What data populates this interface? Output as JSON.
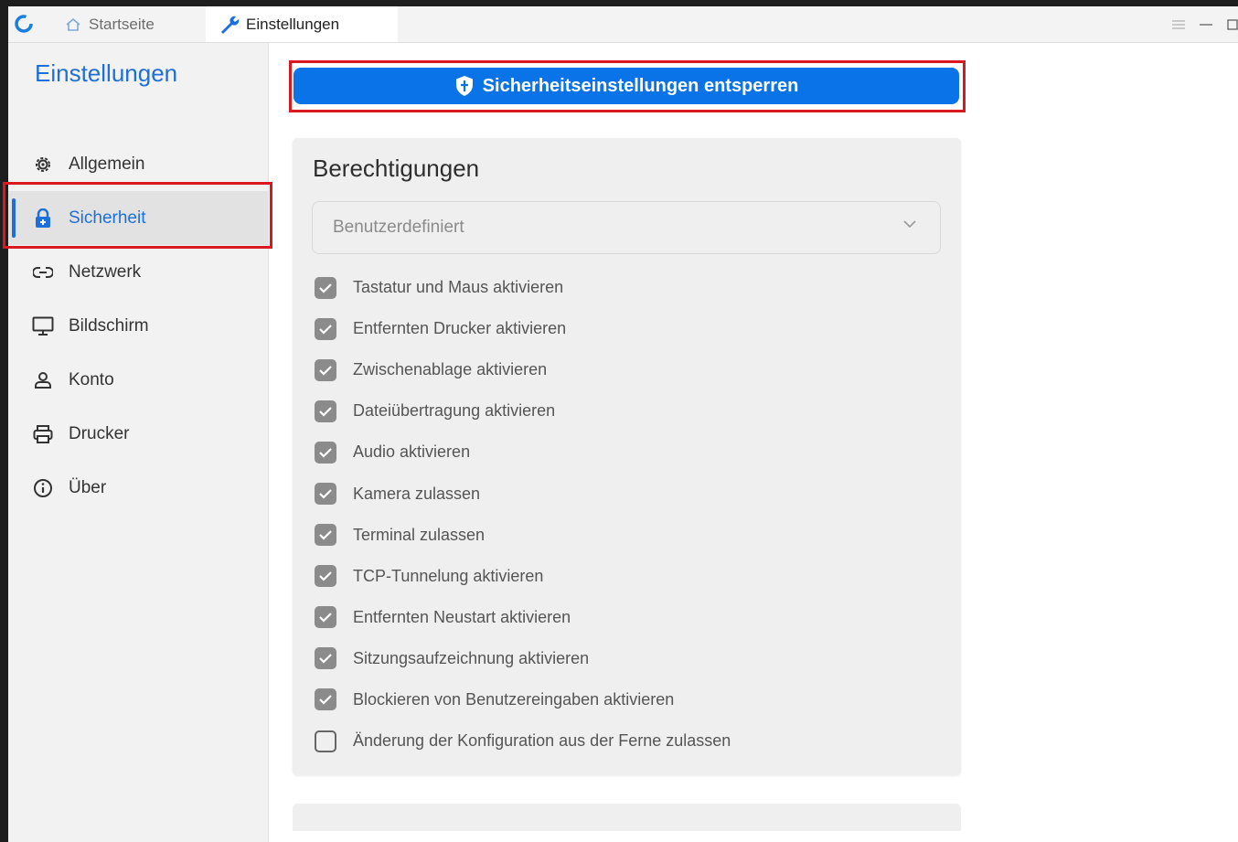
{
  "tabs": {
    "home_label": "Startseite",
    "settings_label": "Einstellungen"
  },
  "sidebar": {
    "title": "Einstellungen",
    "items": [
      {
        "label": "Allgemein",
        "icon": "gear-icon"
      },
      {
        "label": "Sicherheit",
        "icon": "lock-icon",
        "active": true
      },
      {
        "label": "Netzwerk",
        "icon": "link-icon"
      },
      {
        "label": "Bildschirm",
        "icon": "monitor-icon"
      },
      {
        "label": "Konto",
        "icon": "user-icon"
      },
      {
        "label": "Drucker",
        "icon": "printer-icon"
      },
      {
        "label": "Über",
        "icon": "info-icon"
      }
    ]
  },
  "unlock_button": {
    "label": "Sicherheitseinstellungen entsperren",
    "icon": "shield-icon"
  },
  "permissions": {
    "title": "Berechtigungen",
    "preset_value": "Benutzerdefiniert",
    "options": [
      {
        "label": "Tastatur und Maus aktivieren",
        "checked": true
      },
      {
        "label": "Entfernten Drucker aktivieren",
        "checked": true
      },
      {
        "label": "Zwischenablage aktivieren",
        "checked": true
      },
      {
        "label": "Dateiübertragung aktivieren",
        "checked": true
      },
      {
        "label": "Audio aktivieren",
        "checked": true
      },
      {
        "label": "Kamera zulassen",
        "checked": true
      },
      {
        "label": "Terminal zulassen",
        "checked": true
      },
      {
        "label": "TCP-Tunnelung aktivieren",
        "checked": true
      },
      {
        "label": "Entfernten Neustart aktivieren",
        "checked": true
      },
      {
        "label": "Sitzungsaufzeichnung aktivieren",
        "checked": true
      },
      {
        "label": "Blockieren von Benutzereingaben aktivieren",
        "checked": true
      },
      {
        "label": "Änderung der Konfiguration aus der Ferne zulassen",
        "checked": false
      }
    ]
  },
  "colors": {
    "accent": "#1e6fd9",
    "button": "#0b73e8",
    "highlight": "#d9181f",
    "checkbox_checked": "#8b8b8b"
  }
}
